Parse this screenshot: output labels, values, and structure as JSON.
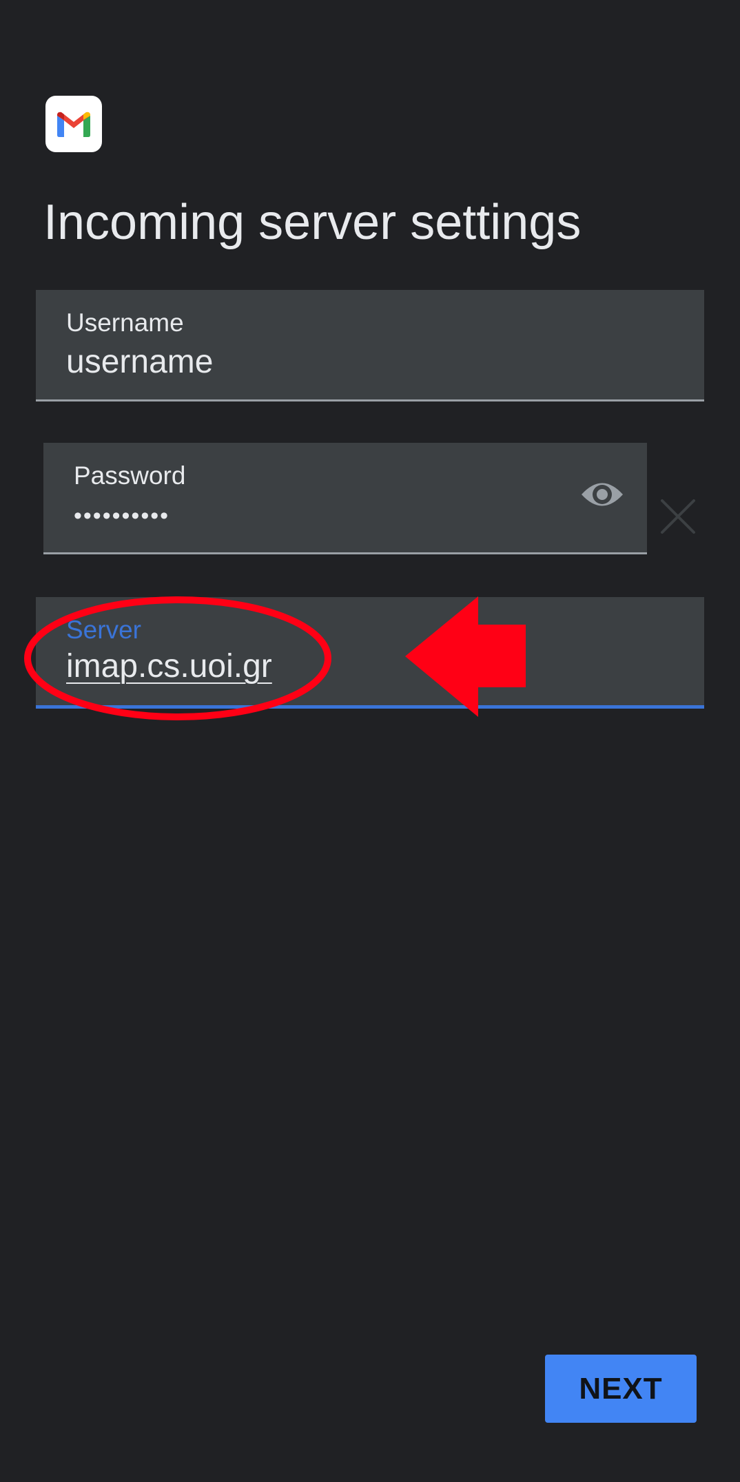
{
  "app": {
    "logo": "gmail-logo"
  },
  "page": {
    "title": "Incoming server settings"
  },
  "form": {
    "username": {
      "label": "Username",
      "value": "username"
    },
    "password": {
      "label": "Password",
      "value": "••••••••••",
      "toggle_icon": "eye-icon",
      "clear_icon": "close-icon"
    },
    "server": {
      "label": "Server",
      "value": "imap.cs.uoi.gr"
    }
  },
  "actions": {
    "next_label": "NEXT"
  },
  "colors": {
    "background": "#202124",
    "field_background": "#3c4043",
    "accent": "#3a74d8",
    "button": "#4285f4",
    "annotation": "#ff0015"
  }
}
